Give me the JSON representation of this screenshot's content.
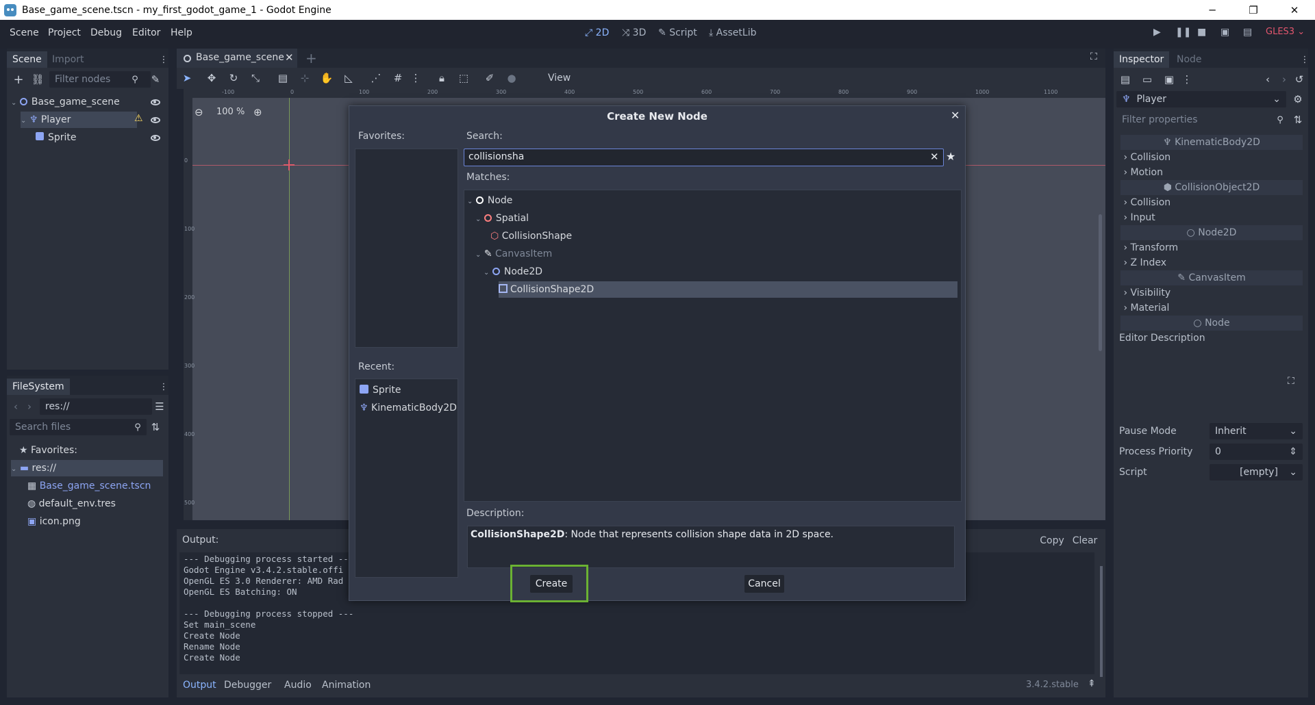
{
  "window": {
    "title": "Base_game_scene.tscn - my_first_godot_game_1 - Godot Engine",
    "min": "─",
    "max": "❐",
    "close": "✕"
  },
  "menu": [
    "Scene",
    "Project",
    "Debug",
    "Editor",
    "Help"
  ],
  "workspaces": [
    "2D",
    "3D",
    "Script",
    "AssetLib"
  ],
  "renderer": "GLES3",
  "scene_panel": {
    "tabs": [
      "Scene",
      "Import"
    ],
    "filter_placeholder": "Filter nodes",
    "tree": [
      {
        "label": "Base_game_scene"
      },
      {
        "label": "Player"
      },
      {
        "label": "Sprite"
      }
    ]
  },
  "filesystem": {
    "tab": "FileSystem",
    "path": "res://",
    "search_placeholder": "Search files",
    "items": [
      "Favorites:",
      "res://",
      "Base_game_scene.tscn",
      "default_env.tres",
      "icon.png"
    ]
  },
  "scene_tab": {
    "label": "Base_game_scene"
  },
  "toolbar": {
    "view": "View",
    "zoom": "100 %"
  },
  "ruler_ticks": [
    "-100",
    "0",
    "100",
    "200",
    "300",
    "400",
    "500",
    "600",
    "700",
    "800",
    "900",
    "1000",
    "1100"
  ],
  "ruler_v_ticks": [
    "0",
    "100",
    "200",
    "300",
    "400",
    "500"
  ],
  "dialog": {
    "title": "Create New Node",
    "favorites_label": "Favorites:",
    "search_label": "Search:",
    "search_value": "collisionsha",
    "matches_label": "Matches:",
    "recent_label": "Recent:",
    "description_label": "Description:",
    "description_name": "CollisionShape2D",
    "description_text": ": Node that represents collision shape data in 2D space.",
    "create": "Create",
    "cancel": "Cancel",
    "matches": [
      {
        "label": "Node"
      },
      {
        "label": "Spatial"
      },
      {
        "label": "CollisionShape"
      },
      {
        "label": "CanvasItem"
      },
      {
        "label": "Node2D"
      },
      {
        "label": "CollisionShape2D"
      }
    ],
    "recent": [
      "Sprite",
      "KinematicBody2D"
    ]
  },
  "output": {
    "label": "Output:",
    "copy": "Copy",
    "clear": "Clear",
    "version": "3.4.2.stable",
    "lines": [
      "--- Debugging process started ---",
      "Godot Engine v3.4.2.stable.offi",
      "OpenGL ES 3.0 Renderer: AMD Rad",
      "OpenGL ES Batching: ON",
      "",
      "--- Debugging process stopped ---",
      "Set main_scene",
      "Create Node",
      "Rename Node",
      "Create Node"
    ],
    "tabs": [
      "Output",
      "Debugger",
      "Audio",
      "Animation"
    ]
  },
  "inspector": {
    "tabs": [
      "Inspector",
      "Node"
    ],
    "object": "Player",
    "filter_placeholder": "Filter properties",
    "sections": [
      {
        "header": "KinematicBody2D",
        "items": [
          "Collision",
          "Motion"
        ]
      },
      {
        "header": "CollisionObject2D",
        "items": [
          "Collision",
          "Input"
        ]
      },
      {
        "header": "Node2D",
        "items": [
          "Transform",
          "Z Index"
        ]
      },
      {
        "header": "CanvasItem",
        "items": [
          "Visibility",
          "Material"
        ]
      },
      {
        "header": "Node",
        "items": []
      }
    ],
    "editor_description": "Editor Description",
    "props": [
      {
        "name": "Pause Mode",
        "value": "Inherit"
      },
      {
        "name": "Process Priority",
        "value": "0"
      },
      {
        "name": "Script",
        "value": "[empty]"
      }
    ]
  }
}
